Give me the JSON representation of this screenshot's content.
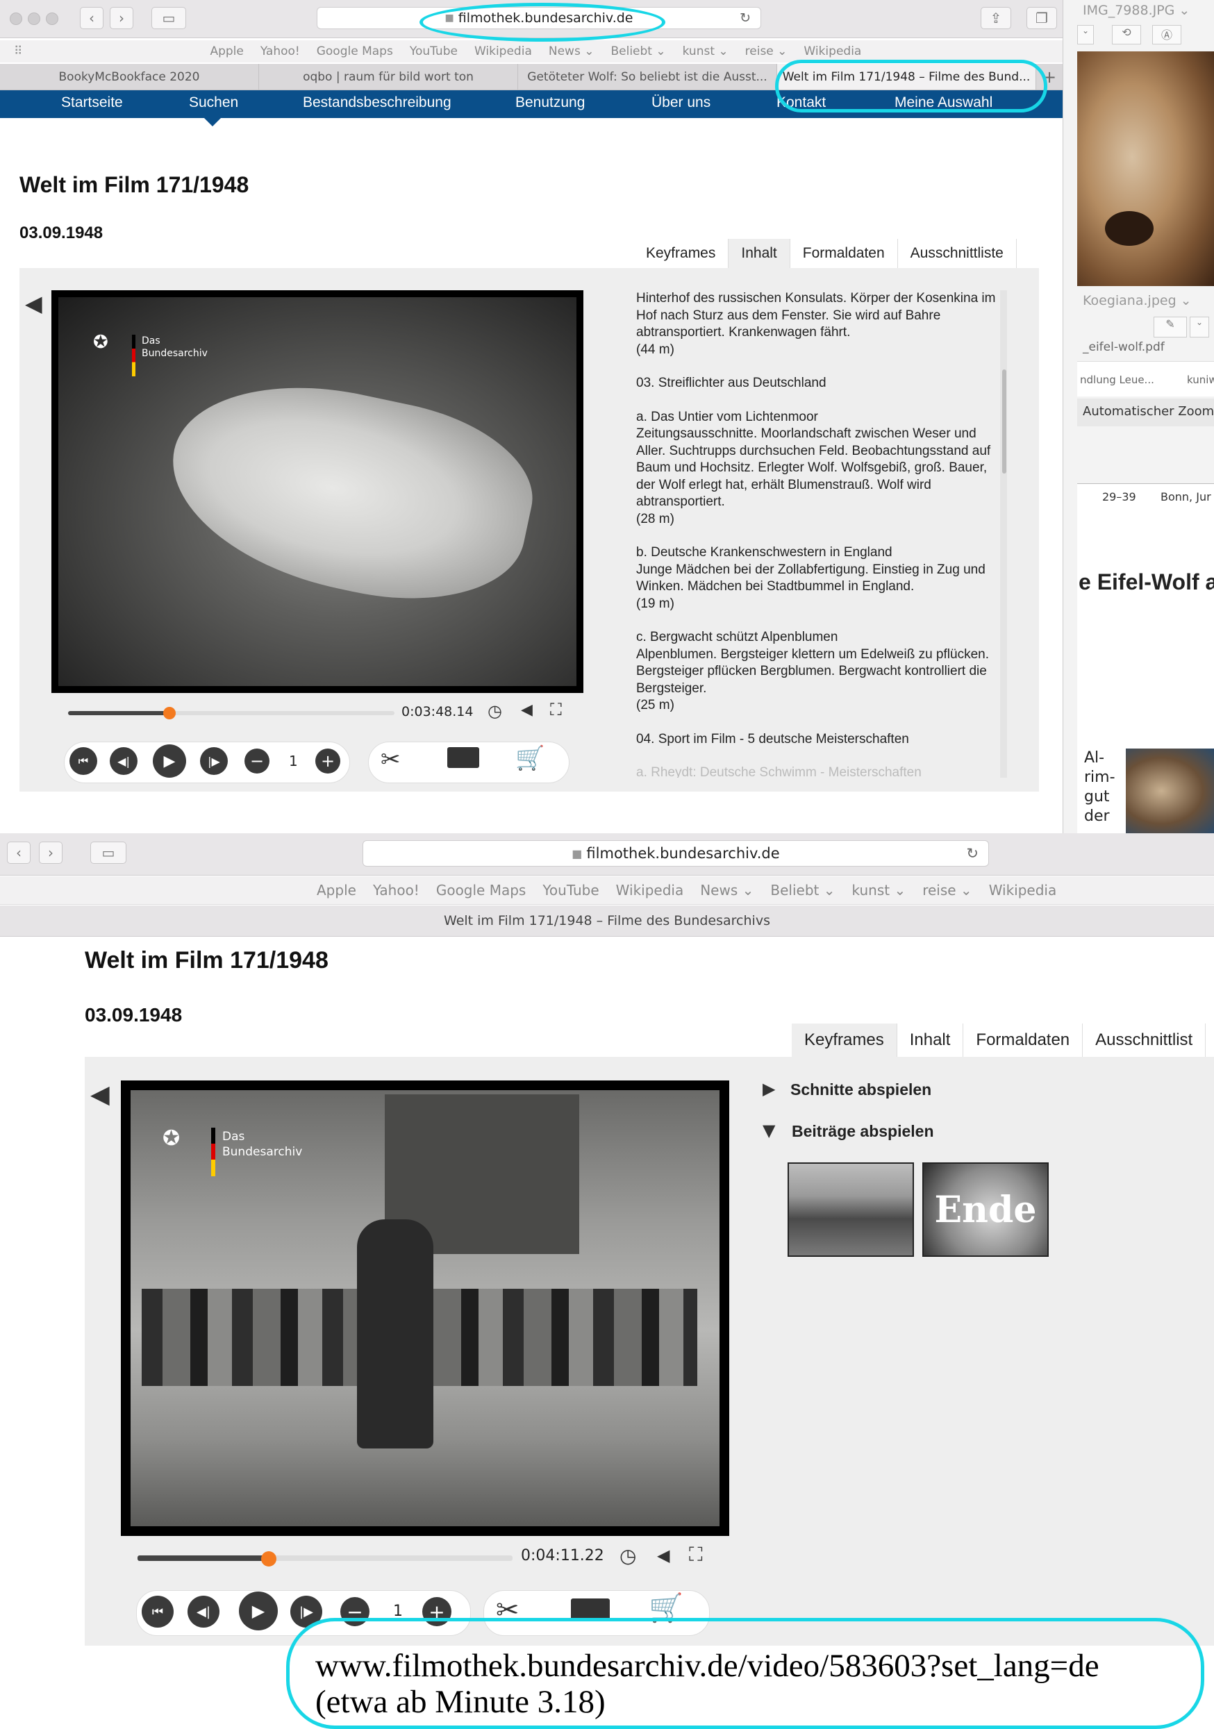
{
  "top": {
    "url": "filmothek.bundesarchiv.de",
    "bookmarks": [
      "Apple",
      "Yahoo!",
      "Google Maps",
      "YouTube",
      "Wikipedia",
      "News ⌄",
      "Beliebt ⌄",
      "kunst ⌄",
      "reise ⌄",
      "Wikipedia"
    ],
    "tabs": [
      "BookyMcBookface 2020",
      "oqbo | raum für bild wort ton",
      "Getöteter Wolf: So beliebt ist die Ausst...",
      "Welt im Film 171/1948 – Filme des Bund..."
    ],
    "nav": [
      "Startseite",
      "Suchen",
      "Bestandsbeschreibung",
      "Benutzung",
      "Über uns",
      "Kontakt",
      "Meine Auswahl"
    ],
    "title": "Welt im Film 171/1948",
    "date": "03.09.1948",
    "content_tabs": [
      "Keyframes",
      "Inhalt",
      "Formaldaten",
      "Ausschnittliste"
    ],
    "watermark": [
      "Das",
      "Bundesarchiv"
    ],
    "time": "0:03:48.14",
    "progress_fraction": 0.31,
    "speed": "1",
    "description": [
      "Hinterhof des russischen Konsulats. Körper der Kosenkina im Hof nach Sturz aus dem Fenster. Sie wird auf Bahre abtransportiert. Krankenwagen fährt.\n(44 m)",
      "03. Streiflichter aus Deutschland",
      "a. Das Untier vom Lichtenmoor\nZeitungsausschnitte. Moorlandschaft zwischen Weser und Aller. Suchtrupps durchsuchen Feld. Beobachtungsstand auf Baum und Hochsitz. Erlegter Wolf. Wolfsgebiß, groß. Bauer, der Wolf erlegt hat, erhält Blumenstrauß. Wolf wird abtransportiert.\n(28 m)",
      "b. Deutsche Krankenschwestern in England\nJunge Mädchen bei der Zollabfertigung. Einstieg in Zug und Winken. Mädchen bei Stadtbummel in England.\n(19 m)",
      "c. Bergwacht schützt Alpenblumen\nAlpenblumen. Bergsteiger klettern um Edelweiß zu pflücken. Bergsteiger pflücken Bergblumen. Bergwacht kontrolliert die Bergsteiger.\n(25 m)",
      "04. Sport im Film - 5 deutsche Meisterschaften",
      "a. Rheydt: Deutsche Schwimm - Meisterschaften"
    ]
  },
  "sidebar": {
    "img_name": "IMG_7988.JPG ⌄",
    "file1": "Koegiana.jpeg ⌄",
    "file2": "_eifel-wolf.pdf",
    "file3": "ndlung Leue...",
    "file4": "kuniw",
    "zoom": "Automatischer Zoom",
    "cell1": "29–39",
    "cell2": "Bonn, Jur",
    "heading": "e Eifel-Wolf an",
    "text": [
      "Al-",
      "rim-",
      "gut",
      "der"
    ]
  },
  "bottom": {
    "url": "filmothek.bundesarchiv.de",
    "bookmarks": [
      "Apple",
      "Yahoo!",
      "Google Maps",
      "YouTube",
      "Wikipedia",
      "News ⌄",
      "Beliebt ⌄",
      "kunst ⌄",
      "reise ⌄",
      "Wikipedia"
    ],
    "tab_title": "Welt im Film 171/1948 – Filme des Bundesarchivs",
    "title": "Welt im Film 171/1948",
    "date": "03.09.1948",
    "content_tabs": [
      "Keyframes",
      "Inhalt",
      "Formaldaten",
      "Ausschnittlist"
    ],
    "watermark": [
      "Das",
      "Bundesarchiv"
    ],
    "time": "0:04:11.22",
    "progress_fraction": 0.35,
    "speed": "1",
    "schnitte": "Schnitte abspielen",
    "beitraege": "Beiträge abspielen",
    "thumb2_text": "Ende"
  },
  "annotation": {
    "line1": "www.filmothek.bundesarchiv.de/video/583603?set_lang=de",
    "line2": "(etwa ab Minute 3.18)"
  },
  "colors": {
    "nav": "#0a4f8a",
    "accent": "#f47a1f",
    "annotation": "#18d6e6"
  }
}
